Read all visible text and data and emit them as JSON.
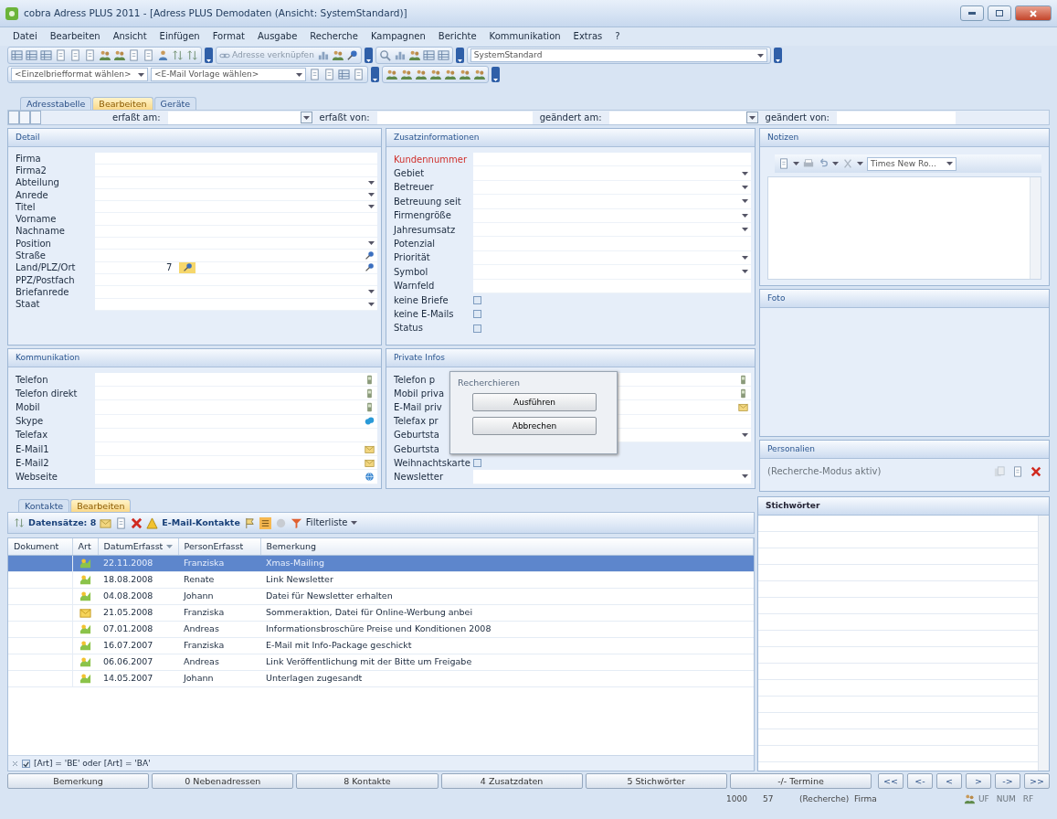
{
  "window": {
    "title": "cobra Adress PLUS 2011 - [Adress PLUS Demodaten (Ansicht: SystemStandard)]"
  },
  "menu": [
    "Datei",
    "Bearbeiten",
    "Ansicht",
    "Einfügen",
    "Format",
    "Ausgabe",
    "Recherche",
    "Kampagnen",
    "Berichte",
    "Kommunikation",
    "Extras",
    "?"
  ],
  "toolbar": {
    "link_button": "Adresse verknüpfen",
    "view_select": "SystemStandard",
    "letter_select": "<Einzelbriefformat wählen>",
    "email_select": "<E-Mail Vorlage wählen>"
  },
  "record_tabs": [
    {
      "label": "Adresstabelle",
      "selected": false
    },
    {
      "label": "Bearbeiten",
      "selected": true
    },
    {
      "label": "Geräte",
      "selected": false
    }
  ],
  "record_header": [
    "erfaßt am:",
    "erfaßt von:",
    "geändert am:",
    "geändert von:"
  ],
  "columns": [
    [
      {
        "title": "Detail",
        "fields": [
          {
            "label": "Firma",
            "kind": "text"
          },
          {
            "label": "Firma2",
            "kind": "text"
          },
          {
            "label": "Abteilung",
            "kind": "combo"
          },
          {
            "label": "Anrede",
            "kind": "combo"
          },
          {
            "label": "Titel",
            "kind": "combo"
          },
          {
            "label": "Vorname",
            "kind": "text"
          },
          {
            "label": "Nachname",
            "kind": "text"
          },
          {
            "label": "Position",
            "kind": "combo"
          },
          {
            "label": "Straße",
            "kind": "address"
          },
          {
            "label": "Land/PLZ/Ort",
            "kind": "postal",
            "value": "7"
          },
          {
            "label": "PPZ/Postfach",
            "kind": "text"
          },
          {
            "label": "Briefanrede",
            "kind": "combo"
          },
          {
            "label": "Staat",
            "kind": "combo"
          }
        ]
      },
      {
        "title": "Kommunikation",
        "fields": [
          {
            "label": "Telefon",
            "kind": "phone"
          },
          {
            "label": "Telefon direkt",
            "kind": "phone"
          },
          {
            "label": "Mobil",
            "kind": "phone"
          },
          {
            "label": "Skype",
            "kind": "skype"
          },
          {
            "label": "Telefax",
            "kind": "text"
          },
          {
            "label": "E-Mail1",
            "kind": "email"
          },
          {
            "label": "E-Mail2",
            "kind": "email"
          },
          {
            "label": "Webseite",
            "kind": "web"
          }
        ]
      }
    ],
    [
      {
        "title": "Zusatzinformationen",
        "fields": [
          {
            "label": "Kundennummer",
            "kind": "id"
          },
          {
            "label": "Gebiet",
            "kind": "combo"
          },
          {
            "label": "Betreuer",
            "kind": "combo"
          },
          {
            "label": "Betreuung seit",
            "kind": "combo"
          },
          {
            "label": "Firmengröße",
            "kind": "combo"
          },
          {
            "label": "Jahresumsatz",
            "kind": "combo"
          },
          {
            "label": "Potenzial",
            "kind": "text"
          },
          {
            "label": "Priorität",
            "kind": "combo"
          },
          {
            "label": "Symbol",
            "kind": "combo"
          },
          {
            "label": "Warnfeld",
            "kind": "text"
          },
          {
            "label": "keine Briefe",
            "kind": "checkbox",
            "checked": false
          },
          {
            "label": "keine E-Mails",
            "kind": "checkbox",
            "checked": false
          },
          {
            "label": "Status",
            "kind": "checkbox",
            "checked": false
          }
        ]
      },
      {
        "title": "Private Infos",
        "fields": [
          {
            "label": "Telefon p",
            "kind": "phone"
          },
          {
            "label": "Mobil priva",
            "kind": "phone"
          },
          {
            "label": "E-Mail priv",
            "kind": "email"
          },
          {
            "label": "Telefax pr",
            "kind": "text"
          },
          {
            "label": "Geburtsta",
            "kind": "combo"
          },
          {
            "label": "Geburtsta",
            "kind": "label"
          },
          {
            "label": "Weihnachtskarte",
            "kind": "checkbox",
            "checked": false
          },
          {
            "label": "Newsletter",
            "kind": "combo"
          }
        ]
      }
    ]
  ],
  "notes": {
    "title": "Notizen",
    "font": "Times New Ro..."
  },
  "photo": {
    "title": "Foto"
  },
  "personal": {
    "title": "Personalien",
    "text": "(Recherche-Modus aktiv)"
  },
  "dialog": {
    "title": "Recherchieren",
    "buttons": [
      "Ausführen",
      "Abbrechen"
    ]
  },
  "contacts": {
    "tabs": [
      {
        "label": "Kontakte",
        "selected": false
      },
      {
        "label": "Bearbeiten",
        "selected": true
      }
    ],
    "toolbar": {
      "records": "Datensätze: 8",
      "email": "E-Mail-Kontakte",
      "filter": "Filterliste"
    },
    "columns": [
      {
        "label": "Dokument",
        "sorted": false
      },
      {
        "label": "Art",
        "sorted": false
      },
      {
        "label": "DatumErfasst",
        "sorted": true
      },
      {
        "label": "PersonErfasst",
        "sorted": false
      },
      {
        "label": "Bemerkung",
        "sorted": false
      }
    ],
    "rows": [
      {
        "kind": "meeting",
        "date": "22.11.2008",
        "person": "Franziska",
        "note": "Xmas-Mailing",
        "selected": true
      },
      {
        "kind": "meeting",
        "date": "18.08.2008",
        "person": "Renate",
        "note": "Link Newsletter",
        "selected": false
      },
      {
        "kind": "meeting",
        "date": "04.08.2008",
        "person": "Johann",
        "note": "Datei für Newsletter erhalten",
        "selected": false
      },
      {
        "kind": "letter",
        "date": "21.05.2008",
        "person": "Franziska",
        "note": "Sommeraktion, Datei für Online-Werbung anbei",
        "selected": false
      },
      {
        "kind": "meeting",
        "date": "07.01.2008",
        "person": "Andreas",
        "note": "Informationsbroschüre Preise und Konditionen 2008",
        "selected": false
      },
      {
        "kind": "meeting",
        "date": "16.07.2007",
        "person": "Franziska",
        "note": "E-Mail mit Info-Package geschickt",
        "selected": false
      },
      {
        "kind": "meeting",
        "date": "06.06.2007",
        "person": "Andreas",
        "note": "Link Veröffentlichung mit der Bitte um Freigabe",
        "selected": false
      },
      {
        "kind": "meeting",
        "date": "14.05.2007",
        "person": "Johann",
        "note": "Unterlagen zugesandt",
        "selected": false
      }
    ],
    "filter": {
      "checked": true,
      "text": "[Art] = 'BE' oder [Art] = 'BA'"
    }
  },
  "keywords": {
    "title": "Stichwörter"
  },
  "bottom_buttons": [
    "Bemerkung",
    "0 Nebenadressen",
    "8 Kontakte",
    "4 Zusatzdaten",
    "5 Stichwörter",
    "-/- Termine"
  ],
  "nav_buttons": [
    "<<",
    "<-",
    "<",
    ">",
    "->",
    ">>"
  ],
  "status_bar": {
    "texts": [
      "1000",
      "57",
      "(Recherche)",
      "Firma"
    ],
    "indicators": [
      "UF",
      "NUM",
      "RF"
    ]
  }
}
